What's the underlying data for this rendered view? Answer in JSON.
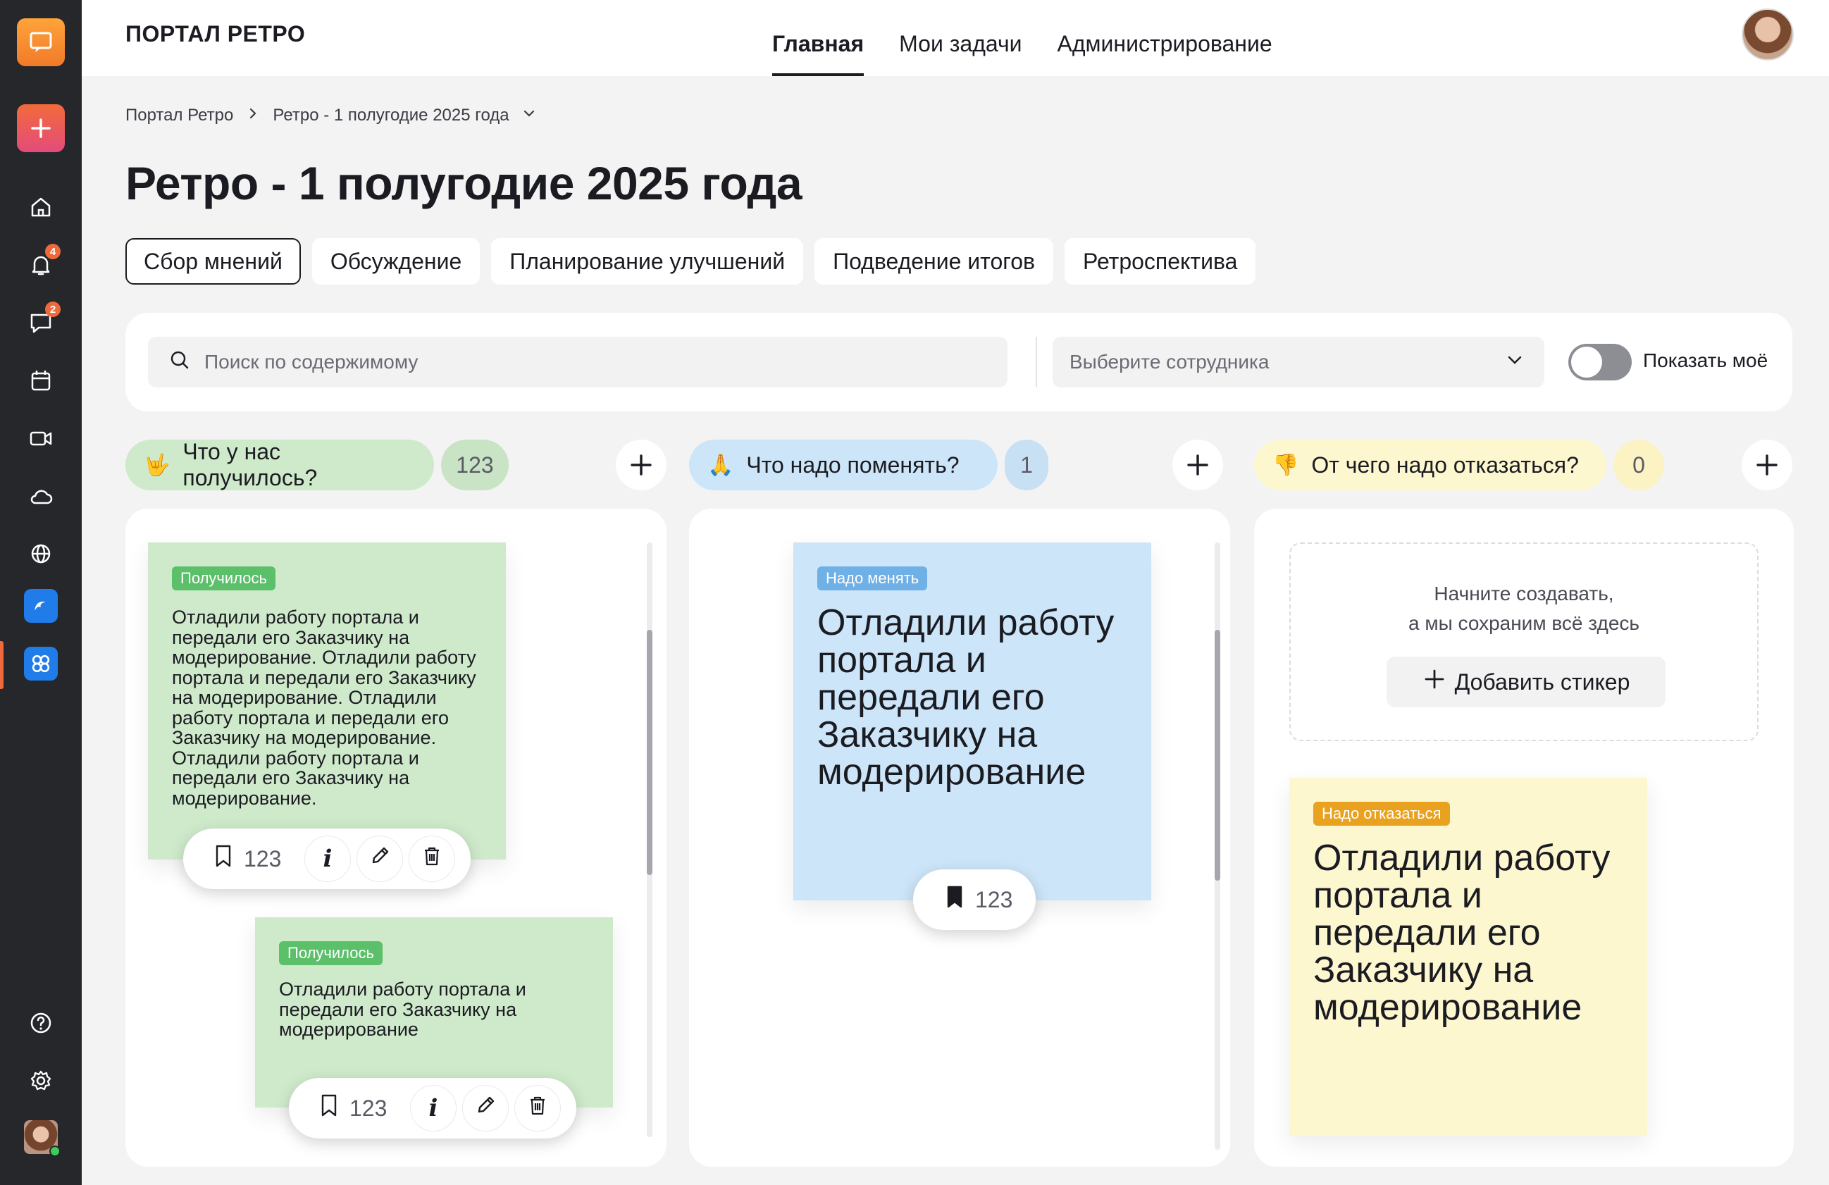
{
  "app": {
    "brand": "ПОРТАЛ РЕТРО",
    "accent": "#ee6a3a"
  },
  "rail": {
    "items": [
      {
        "icon": "chat-logo-icon"
      },
      {
        "icon": "plus-icon"
      },
      {
        "icon": "home-icon"
      },
      {
        "icon": "bell-icon",
        "badge": "4"
      },
      {
        "icon": "message-icon",
        "badge": "2"
      },
      {
        "icon": "calendar-icon"
      },
      {
        "icon": "video-icon"
      },
      {
        "icon": "cloud-icon"
      },
      {
        "icon": "globe-icon"
      },
      {
        "icon": "app-blue-icon"
      },
      {
        "icon": "retro-app-icon"
      },
      {
        "icon": "help-icon"
      },
      {
        "icon": "settings-icon"
      },
      {
        "icon": "user-avatar"
      }
    ]
  },
  "nav": {
    "items": [
      "Главная",
      "Мои задачи",
      "Администрирование"
    ],
    "active": "Главная"
  },
  "breadcrumb": {
    "root": "Портал Ретро",
    "current": "Ретро -  1 полугодие 2025 года"
  },
  "page": {
    "title": "Ретро - 1 полугодие 2025 года"
  },
  "tabs": [
    "Сбор мнений",
    "Обсуждение",
    "Планирование улучшений",
    "Подведение итогов",
    "Ретроспектива"
  ],
  "filters": {
    "search_placeholder": "Поиск по содержимому",
    "employee_placeholder": "Выберите сотрудника",
    "toggle_label": "Показать моё",
    "toggle_on": false
  },
  "columns": [
    {
      "emoji": "🤟",
      "title": "Что у нас получилось?",
      "count": "123",
      "color": "#cfeacb",
      "count_color": "#c8e4c4",
      "stickers": [
        {
          "tag": "Получилось",
          "text": "Отладили работу портала и передали его Заказчику на модерирование.  Отладили работу портала и передали его Заказчику на модерирование. Отладили работу портала и передали его Заказчику на модерирование.  Отладили работу портала и передали его Заказчику на модерирование.",
          "likes": "123"
        },
        {
          "tag": "Получилось",
          "text": "Отладили работу портала и передали его Заказчику на модерирование",
          "likes": "123"
        }
      ]
    },
    {
      "emoji": "🙏",
      "title": "Что надо поменять?",
      "count": "1",
      "color": "#cde5f8",
      "count_color": "#c8e0f4",
      "stickers": [
        {
          "tag": "Надо менять",
          "text": "Отладили работу портала и передали его Заказчику на модерирование",
          "likes": "123"
        }
      ]
    },
    {
      "emoji": "👎",
      "title": "От чего надо отказаться?",
      "count": "0",
      "color": "#fdf7cf",
      "count_color": "#fbf3c4",
      "empty_text_1": "Начните создавать,",
      "empty_text_2": "а мы сохраним всё здесь",
      "add_sticker": "Добавить стикер",
      "stickers": [
        {
          "tag": "Надо отказаться",
          "text": "Отладили работу портала и передали его Заказчику на модерирование"
        }
      ]
    }
  ],
  "colors": {
    "green_sticker": "#cfeacb",
    "green_tag": "#5cbf6a",
    "blue_sticker": "#cde5f8",
    "blue_tag": "#6fb0e6",
    "yellow_sticker": "#fdf7cf",
    "yellow_tag": "#e8a21f"
  }
}
